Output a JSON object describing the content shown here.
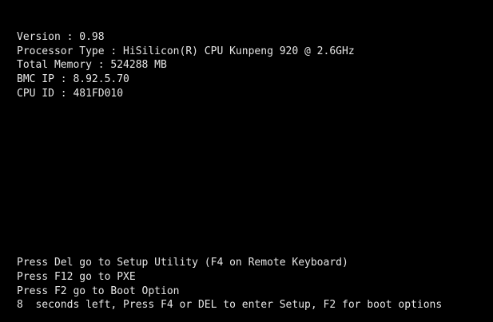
{
  "system_info": {
    "version": "Version : 0.98",
    "processor": "Processor Type : HiSilicon(R) CPU Kunpeng 920 @ 2.6GHz",
    "memory": "Total Memory : 524288 MB",
    "bmc_ip": "BMC IP : 8.92.5.70",
    "cpu_id": "CPU ID : 481FD010"
  },
  "prompts": {
    "setup": "Press Del go to Setup Utility (F4 on Remote Keyboard)",
    "pxe": "Press F12 go to PXE",
    "boot_option": "Press F2 go to Boot Option",
    "countdown": "8  seconds left, Press F4 or DEL to enter Setup, F2 for boot options"
  },
  "colors": {
    "background": "#000000",
    "text": "#e6e6e6"
  }
}
